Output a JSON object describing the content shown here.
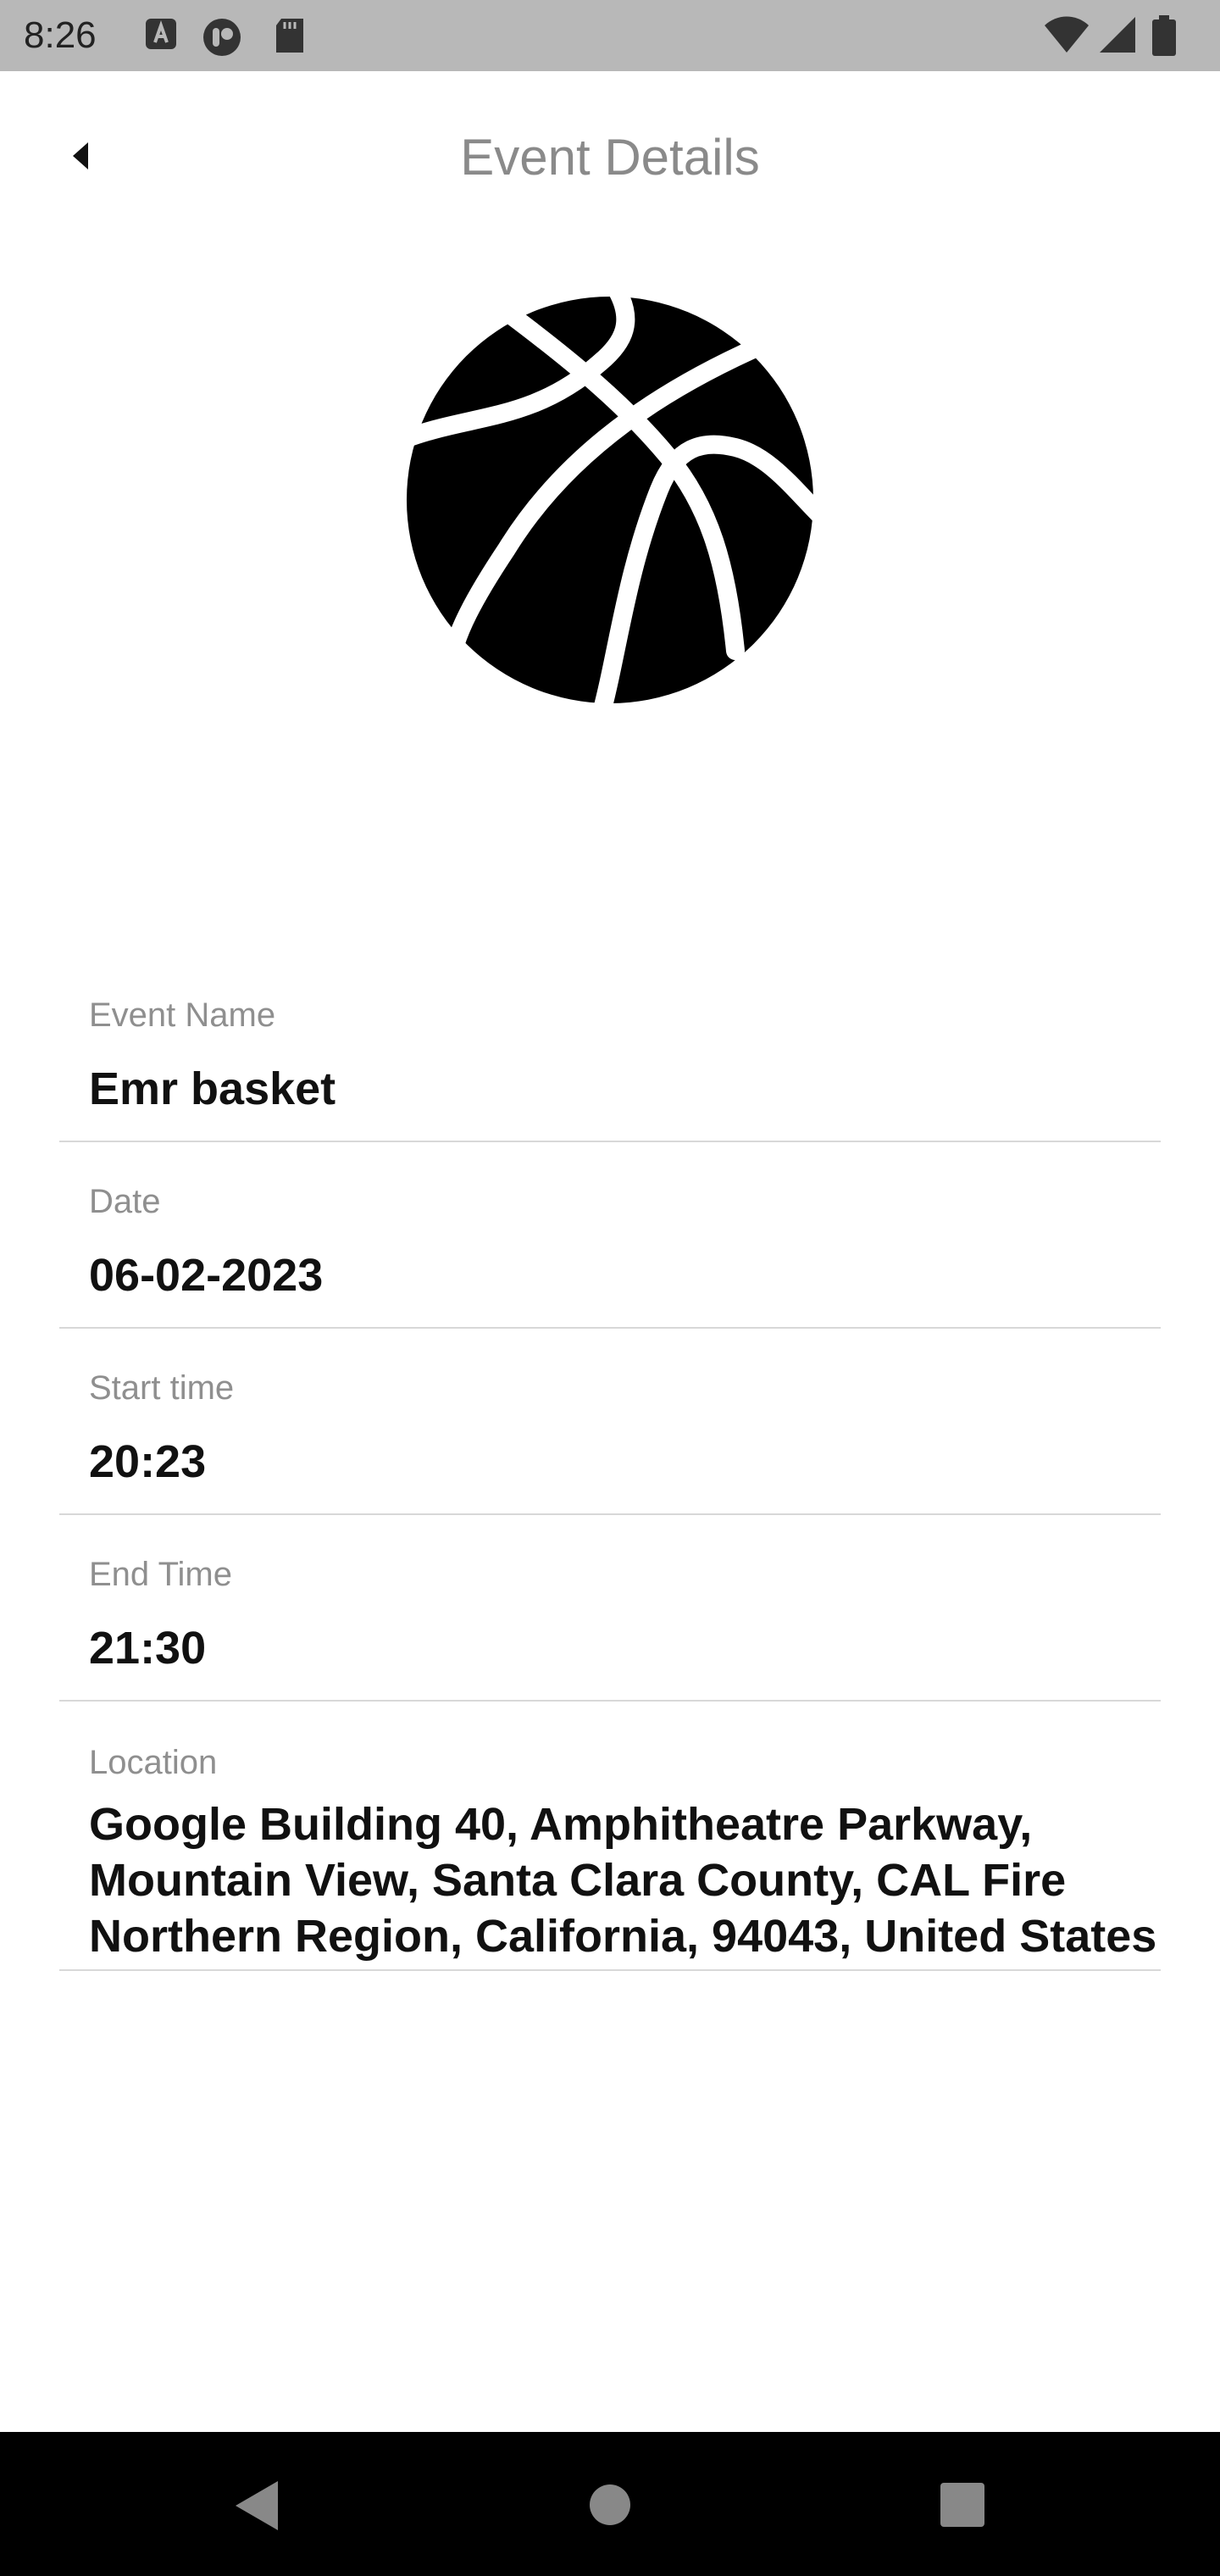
{
  "status_bar": {
    "time": "8:26",
    "left_icons": [
      "keyboard-a-icon",
      "circle-app-icon",
      "sd-card-icon"
    ],
    "right_icons": [
      "wifi-icon",
      "signal-icon",
      "battery-icon"
    ]
  },
  "app_bar": {
    "title": "Event Details",
    "back_icon": "back-arrow-icon"
  },
  "hero_icon": "basketball-icon",
  "fields": {
    "event_name": {
      "label": "Event Name",
      "value": "Emr basket"
    },
    "date": {
      "label": "Date",
      "value": "06-02-2023"
    },
    "start_time": {
      "label": "Start time",
      "value": "20:23"
    },
    "end_time": {
      "label": "End Time",
      "value": "21:30"
    },
    "location": {
      "label": "Location",
      "value": "Google Building 40, Amphitheatre Parkway, Mountain View, Santa Clara County, CAL Fire Northern Region, California, 94043, United States"
    }
  },
  "nav_bar": {
    "buttons": [
      "back-triangle-icon",
      "home-circle-icon",
      "recents-square-icon"
    ]
  }
}
